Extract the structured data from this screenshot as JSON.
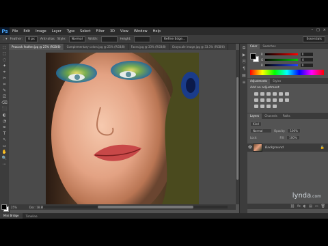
{
  "app": {
    "logo": "Ps"
  },
  "menu": [
    "File",
    "Edit",
    "Image",
    "Layer",
    "Type",
    "Select",
    "Filter",
    "3D",
    "View",
    "Window",
    "Help"
  ],
  "window_controls": [
    "–",
    "□",
    "×"
  ],
  "options": {
    "feather_label": "Feather:",
    "feather_value": "0 px",
    "antialias_label": "Anti-alias",
    "style_label": "Style:",
    "style_value": "Normal",
    "width_label": "Width:",
    "height_label": "Height:",
    "refine_label": "Refine Edge...",
    "workspace": "Essentials"
  },
  "doc_tabs": [
    {
      "label": "Peacock feather.jpg @ 25% (RGB/8)",
      "active": true
    },
    {
      "label": "Complementary colors.jpg @ 25% (RGB/8)",
      "active": false
    },
    {
      "label": "Faces.jpg @ 33% (RGB/8)",
      "active": false
    },
    {
      "label": "Grayscale image.jpg @ 33.3% (RGB/8)",
      "active": false
    }
  ],
  "tools": [
    "⬚",
    "⬚",
    "◌",
    "✦",
    "⌖",
    "✂",
    "⌗",
    "✎",
    "⎚",
    "⌫",
    "⬛",
    "◐",
    "◔",
    "✒",
    "T",
    "↖",
    "▭",
    "✋",
    "🔍",
    "⋯"
  ],
  "status": {
    "zoom": "25%",
    "doc": "Doc: 18.8M/18.8M"
  },
  "bottom_tabs": [
    {
      "label": "Mini Bridge",
      "active": true
    },
    {
      "label": "Timeline",
      "active": false
    }
  ],
  "right_strip_icons": [
    "⧉",
    "▶",
    "Ⓐ",
    "¶",
    "▤",
    "≡"
  ],
  "color_panel": {
    "tabs": [
      {
        "label": "Color",
        "active": true
      },
      {
        "label": "Swatches",
        "active": false
      }
    ],
    "channels": [
      {
        "name": "R",
        "value": "0",
        "color": "#d23b3b"
      },
      {
        "name": "G",
        "value": "0",
        "color": "#3bb33b"
      },
      {
        "name": "B",
        "value": "0",
        "color": "#3b5bd2"
      }
    ]
  },
  "adjustments": {
    "tabs": [
      {
        "label": "Adjustments",
        "active": true
      },
      {
        "label": "Styles",
        "active": false
      }
    ],
    "title": "Add an adjustment"
  },
  "layers": {
    "tabs": [
      {
        "label": "Layers",
        "active": true
      },
      {
        "label": "Channels",
        "active": false
      },
      {
        "label": "Paths",
        "active": false
      }
    ],
    "kind_label": "Kind",
    "blend_mode": "Normal",
    "opacity_label": "Opacity:",
    "opacity_value": "100%",
    "lock_label": "Lock:",
    "fill_label": "Fill:",
    "fill_value": "100%",
    "items": [
      {
        "name": "Background",
        "visible": true,
        "locked": true
      }
    ],
    "footer_icons": [
      "⛓",
      "fx",
      "◐",
      "▤",
      "▭",
      "🗑"
    ]
  },
  "watermark": {
    "brand": "lynda",
    "suffix": ".com"
  }
}
